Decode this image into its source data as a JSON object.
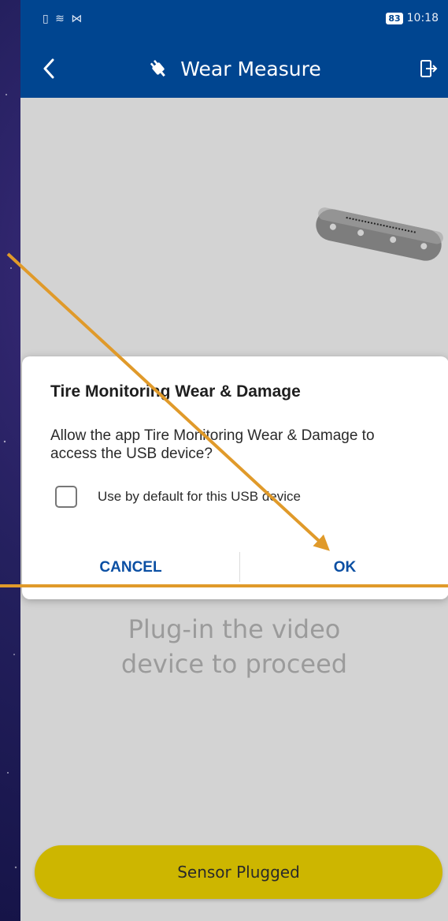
{
  "status_bar": {
    "left_icons": "▯ ≋ ⋈",
    "battery": "83",
    "time": "10:18"
  },
  "app_bar": {
    "title": "Wear Measure",
    "back_icon": "chevron-left-icon",
    "title_icon": "plug-icon",
    "exit_icon": "exit-icon"
  },
  "dialog": {
    "title": "Tire Monitoring Wear & Damage",
    "message": "Allow the app Tire Monitoring Wear & Damage to access the USB device?",
    "checkbox_label": "Use by default for this USB device",
    "checkbox_checked": false,
    "cancel_label": "CANCEL",
    "ok_label": "OK"
  },
  "main": {
    "plug_line1": "Plug-in the video",
    "plug_line2": "device to proceed",
    "sensor_button_label": "Sensor Plugged"
  },
  "colors": {
    "primary": "#004590",
    "button_yellow": "#cdb600",
    "accent_annotation": "#e09a2a",
    "dialog_button_text": "#0b4fa3"
  }
}
